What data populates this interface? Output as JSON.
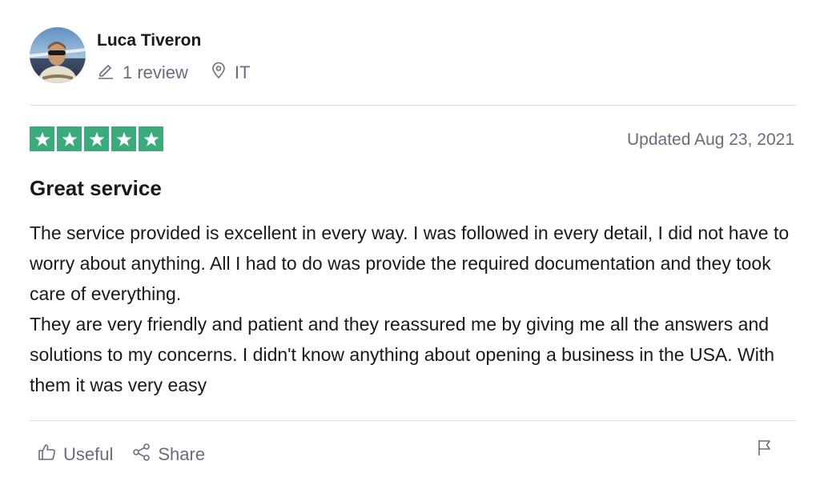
{
  "reviewer": {
    "name": "Luca Tiveron",
    "review_count": "1 review",
    "country": "IT"
  },
  "review": {
    "rating": 5,
    "rating_max": 5,
    "star_color": "#3bab7c",
    "date": "Updated Aug 23, 2021",
    "title": "Great service",
    "paragraphs": [
      "The service provided is excellent in every way. I was followed in every detail, I did not have to worry about anything. All I had to do was provide the required documentation and they took care of everything.",
      "They are very friendly and patient and they reassured me by giving me all the answers and solutions to my concerns. I didn't know anything about opening a business in the USA. With them it was very easy"
    ]
  },
  "actions": {
    "useful_label": "Useful",
    "share_label": "Share"
  },
  "icons": {
    "review_count": "pencil-icon",
    "country": "location-pin-icon",
    "useful": "thumbs-up-icon",
    "share": "share-icon",
    "report": "flag-icon"
  }
}
